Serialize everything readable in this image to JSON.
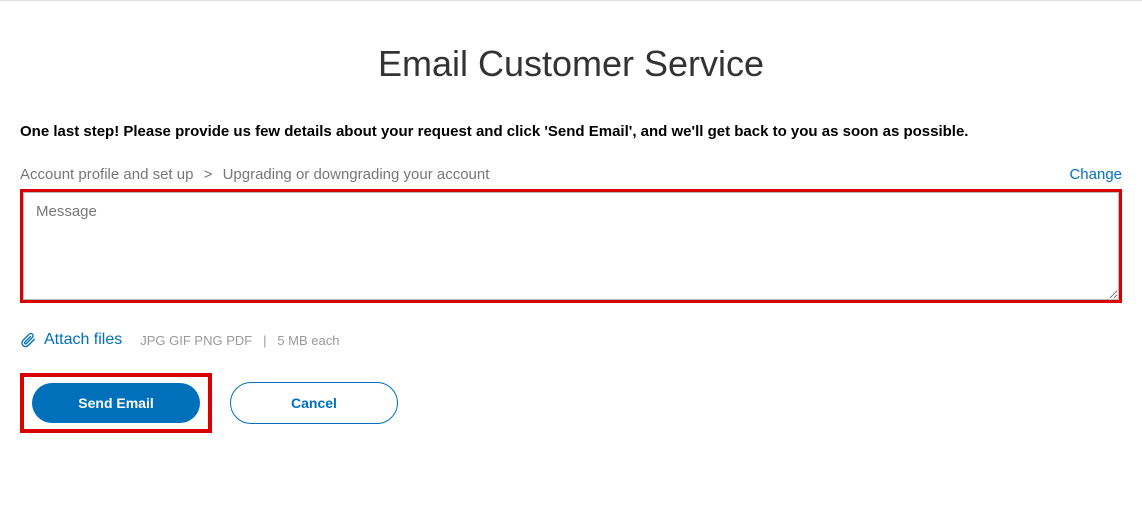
{
  "title": "Email Customer Service",
  "instruction": "One last step! Please provide us few details about your request and click 'Send Email', and we'll get back to you as soon as possible.",
  "breadcrumb": {
    "level1": "Account profile and set up",
    "separator": ">",
    "level2": "Upgrading or downgrading your account"
  },
  "change_link": "Change",
  "message_placeholder": "Message",
  "attach": {
    "label": "Attach files",
    "hint_formats": "JPG GIF PNG PDF",
    "hint_divider": "|",
    "hint_size": "5 MB each"
  },
  "buttons": {
    "send": "Send Email",
    "cancel": "Cancel"
  }
}
